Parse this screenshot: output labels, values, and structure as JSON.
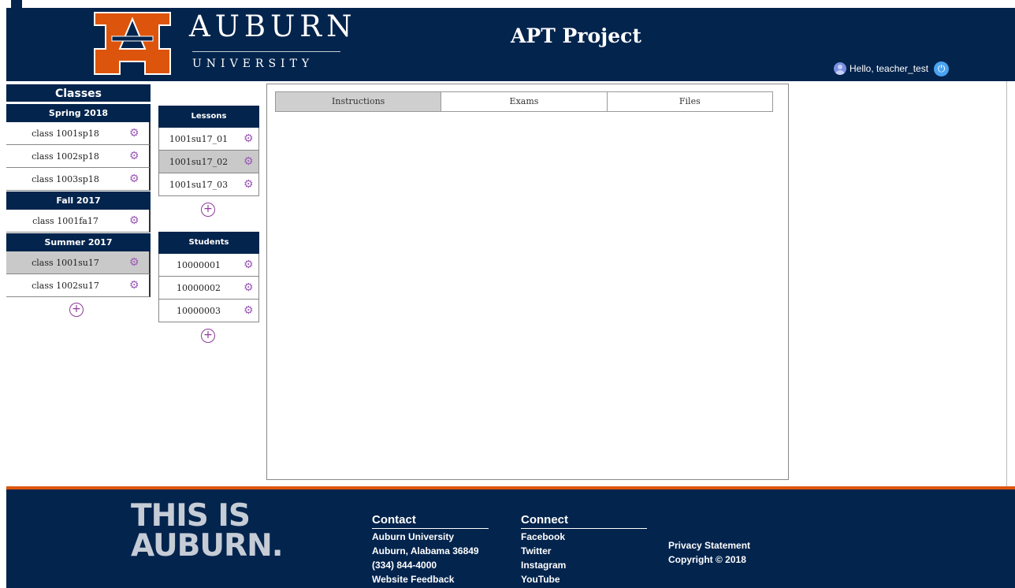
{
  "header": {
    "university_name": "AUBURN",
    "university_sub": "UNIVERSITY",
    "app_title": "APT Project",
    "greeting": "Hello, teacher_test"
  },
  "colors": {
    "navy": "#03244d",
    "orange": "#dd550c",
    "gear": "#9b59b6",
    "selected_row": "#c9c9c9",
    "logout": "#4aa3f0"
  },
  "icons": {
    "user": "user-icon",
    "power": "power-icon",
    "gear": "gear-icon",
    "add": "add-icon"
  },
  "classes": {
    "title": "Classes",
    "terms": [
      {
        "name": "Spring 2018",
        "items": [
          {
            "label": "class 1001sp18",
            "selected": false
          },
          {
            "label": "class 1002sp18",
            "selected": false
          },
          {
            "label": "class 1003sp18",
            "selected": false
          }
        ]
      },
      {
        "name": "Fall 2017",
        "items": [
          {
            "label": "class 1001fa17",
            "selected": false
          }
        ]
      },
      {
        "name": "Summer 2017",
        "items": [
          {
            "label": "class 1001su17",
            "selected": true
          },
          {
            "label": "class 1002su17",
            "selected": false
          }
        ]
      }
    ]
  },
  "lessons": {
    "title": "Lessons",
    "items": [
      {
        "label": "1001su17_01",
        "selected": false
      },
      {
        "label": "1001su17_02",
        "selected": true
      },
      {
        "label": "1001su17_03",
        "selected": false
      }
    ]
  },
  "students": {
    "title": "Students",
    "items": [
      {
        "label": "10000001"
      },
      {
        "label": "10000002"
      },
      {
        "label": "10000003"
      }
    ]
  },
  "tabs": [
    {
      "label": "Instructions",
      "active": true
    },
    {
      "label": "Exams",
      "active": false
    },
    {
      "label": "Files",
      "active": false
    }
  ],
  "footer": {
    "tagline_line1": "THIS IS",
    "tagline_line2": "AUBURN.",
    "contact": {
      "title": "Contact",
      "lines": [
        "Auburn University",
        "Auburn, Alabama 36849",
        "(334) 844-4000",
        "Website Feedback"
      ]
    },
    "connect": {
      "title": "Connect",
      "links": [
        "Facebook",
        "Twitter",
        "Instagram",
        "YouTube"
      ]
    },
    "privacy": "Privacy Statement",
    "copyright": "Copyright © 2018"
  }
}
